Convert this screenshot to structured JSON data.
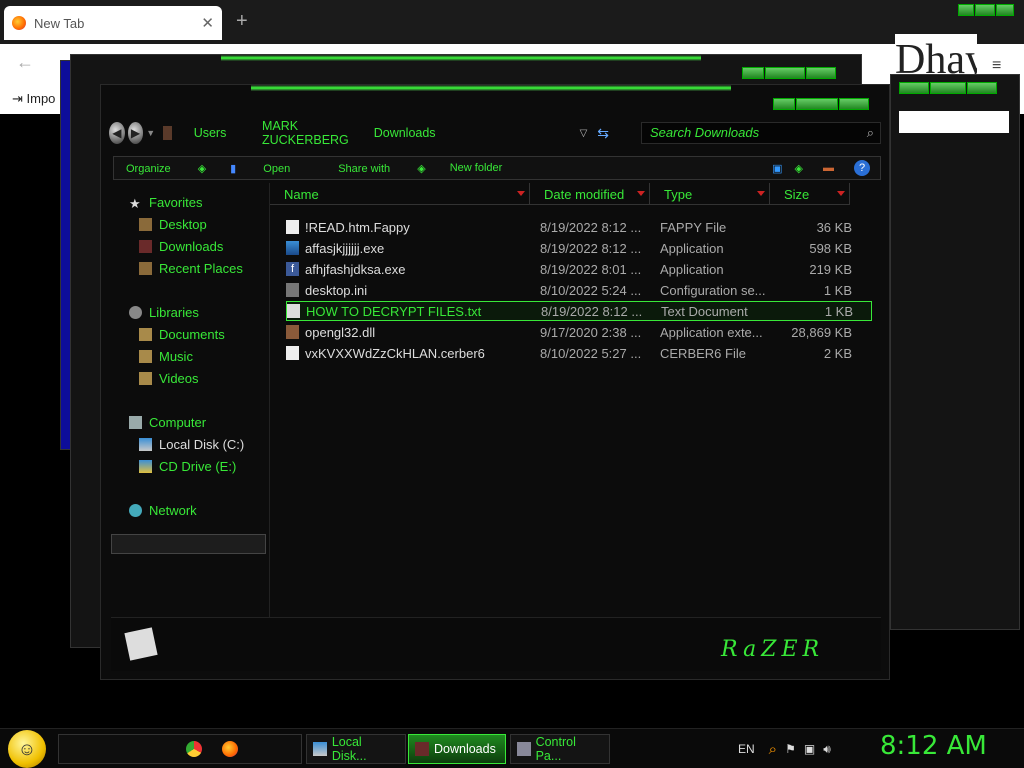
{
  "browser": {
    "tab_title": "New Tab",
    "close_glyph": "✕",
    "new_tab_glyph": "+",
    "back_glyph": "←",
    "import_label": "Impo",
    "ad_text": "Dhay",
    "menu_glyph": "≡"
  },
  "explorer": {
    "breadcrumb": [
      "Users",
      "MARK ZUCKERBERG",
      "Downloads"
    ],
    "search_placeholder": "Search Downloads",
    "toolbar": {
      "organize": "Organize",
      "open": "Open",
      "share_with": "Share with",
      "new_folder": "New folder"
    },
    "nav": {
      "favorites": "Favorites",
      "desktop": "Desktop",
      "downloads": "Downloads",
      "recent_places": "Recent Places",
      "libraries": "Libraries",
      "documents": "Documents",
      "music": "Music",
      "videos": "Videos",
      "computer": "Computer",
      "local_disk": "Local Disk (C:)",
      "cd_drive": "CD Drive (E:)",
      "network": "Network"
    },
    "columns": {
      "name": "Name",
      "date": "Date modified",
      "type": "Type",
      "size": "Size"
    },
    "files": [
      {
        "name": "!READ.htm.Fappy",
        "date": "8/19/2022 8:12 ...",
        "type": "FAPPY File",
        "size": "36 KB",
        "icon": "document-icon"
      },
      {
        "name": "affasjkjjjjjj.exe",
        "date": "8/19/2022 8:12 ...",
        "type": "Application",
        "size": "598 KB",
        "icon": "exe-icon"
      },
      {
        "name": "afhjfashjdksa.exe",
        "date": "8/19/2022 8:01 ...",
        "type": "Application",
        "size": "219 KB",
        "icon": "facebook-icon"
      },
      {
        "name": "desktop.ini",
        "date": "8/10/2022 5:24 ...",
        "type": "Configuration se...",
        "size": "1 KB",
        "icon": "settings-file-icon"
      },
      {
        "name": "HOW TO DECRYPT FILES.txt",
        "date": "8/19/2022 8:12 ...",
        "type": "Text Document",
        "size": "1 KB",
        "icon": "text-file-icon",
        "selected": true
      },
      {
        "name": "opengl32.dll",
        "date": "9/17/2020 2:38 ...",
        "type": "Application exte...",
        "size": "28,869 KB",
        "icon": "dll-icon"
      },
      {
        "name": "vxKVXXWdZzCkHLAN.cerber6",
        "date": "8/10/2022 5:27 ...",
        "type": "CERBER6 File",
        "size": "2 KB",
        "icon": "document-icon"
      }
    ],
    "brand": "RaZER"
  },
  "taskbar": {
    "items": [
      "Local Disk...",
      "Downloads",
      "Control Pa..."
    ],
    "language": "EN",
    "clock": "8:12 AM"
  },
  "colors": {
    "accent": "#38e838",
    "selection": "#0b1a0b"
  }
}
